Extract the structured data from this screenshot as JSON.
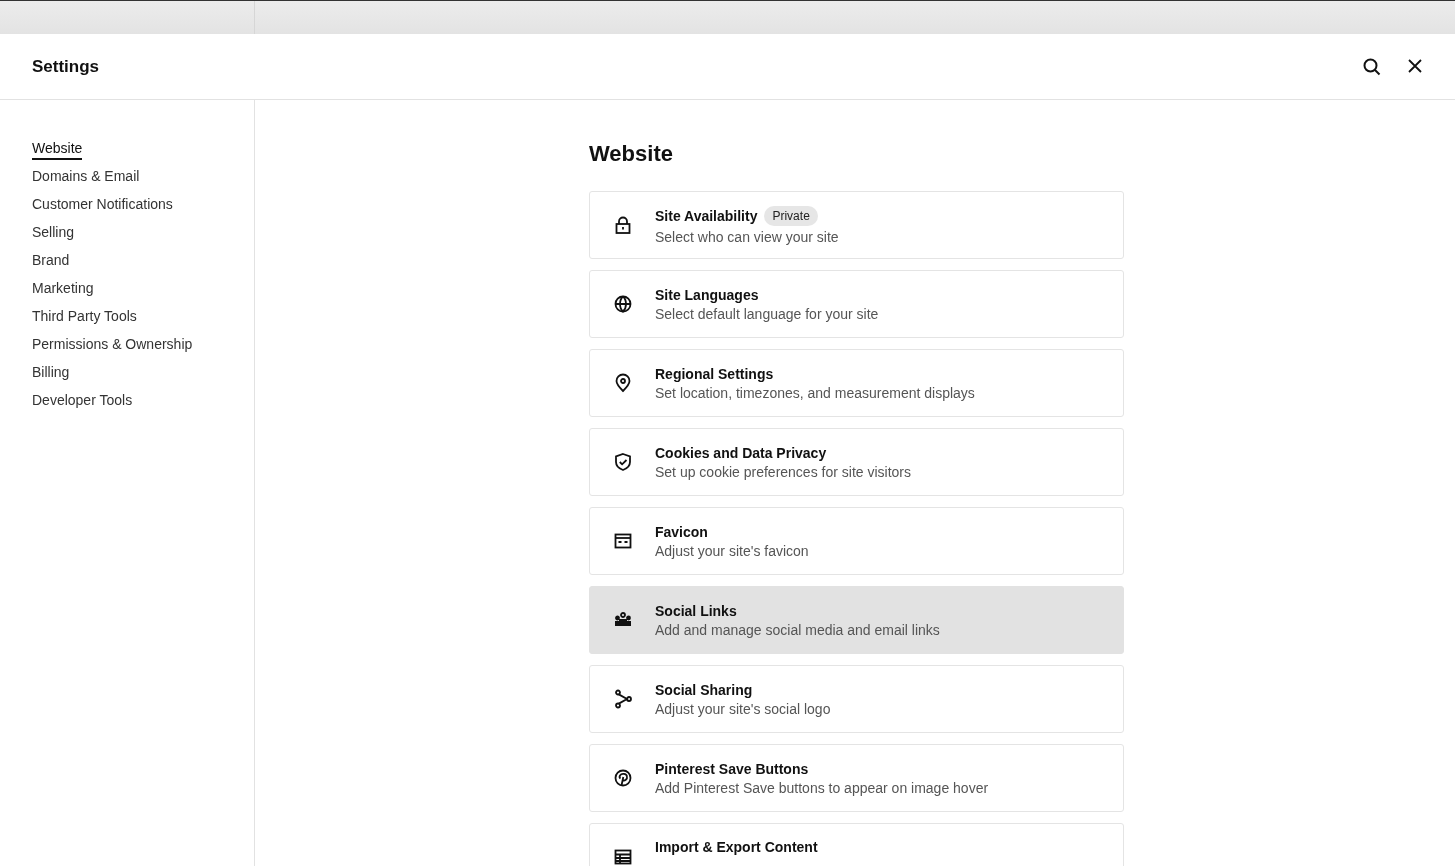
{
  "header": {
    "title": "Settings"
  },
  "sidebar": {
    "items": [
      {
        "label": "Website",
        "selected": true
      },
      {
        "label": "Domains & Email",
        "selected": false
      },
      {
        "label": "Customer Notifications",
        "selected": false
      },
      {
        "label": "Selling",
        "selected": false
      },
      {
        "label": "Brand",
        "selected": false
      },
      {
        "label": "Marketing",
        "selected": false
      },
      {
        "label": "Third Party Tools",
        "selected": false
      },
      {
        "label": "Permissions & Ownership",
        "selected": false
      },
      {
        "label": "Billing",
        "selected": false
      },
      {
        "label": "Developer Tools",
        "selected": false
      }
    ]
  },
  "content": {
    "heading": "Website",
    "cards": [
      {
        "title": "Site Availability",
        "badge": "Private",
        "description": "Select who can view your site",
        "selected": false
      },
      {
        "title": "Site Languages",
        "description": "Select default language for your site",
        "selected": false
      },
      {
        "title": "Regional Settings",
        "description": "Set location, timezones, and measurement displays",
        "selected": false
      },
      {
        "title": "Cookies and Data Privacy",
        "description": "Set up cookie preferences for site visitors",
        "selected": false
      },
      {
        "title": "Favicon",
        "description": "Adjust your site's favicon",
        "selected": false
      },
      {
        "title": "Social Links",
        "description": "Add and manage social media and email links",
        "selected": true
      },
      {
        "title": "Social Sharing",
        "description": "Adjust your site's social logo",
        "selected": false
      },
      {
        "title": "Pinterest Save Buttons",
        "description": "Add Pinterest Save buttons to appear on image hover",
        "selected": false
      },
      {
        "title": "Import & Export Content",
        "selected": false
      }
    ]
  }
}
